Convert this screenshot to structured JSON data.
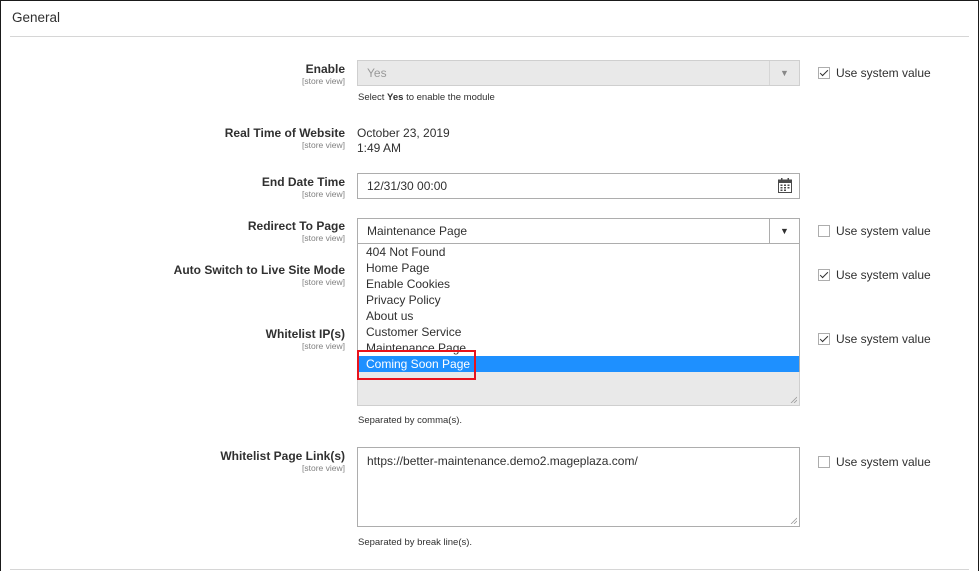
{
  "section": {
    "title": "General"
  },
  "fields": {
    "enable": {
      "label": "Enable",
      "scope": "[store view]",
      "value": "Yes",
      "note_prefix": "Select ",
      "note_bold": "Yes",
      "note_suffix": " to enable the module",
      "use_system_value": "Use system value"
    },
    "real_time": {
      "label": "Real Time of Website",
      "scope": "[store view]",
      "date": "October 23, 2019",
      "time": "1:49 AM"
    },
    "end_date_time": {
      "label": "End Date Time",
      "scope": "[store view]",
      "value": "12/31/30 00:00"
    },
    "redirect_to_page": {
      "label": "Redirect To Page",
      "scope": "[store view]",
      "value": "Maintenance Page",
      "use_system_value": "Use system value",
      "options": [
        "404 Not Found",
        "Home Page",
        "Enable Cookies",
        "Privacy Policy",
        "About us",
        "Customer Service",
        "Maintenance Page",
        "Coming Soon Page"
      ]
    },
    "auto_switch": {
      "label": "Auto Switch to Live Site Mode",
      "scope": "[store view]",
      "use_system_value": "Use system value"
    },
    "whitelist_ips": {
      "label": "Whitelist IP(s)",
      "scope": "[store view]",
      "note": "Separated by comma(s).",
      "use_system_value": "Use system value"
    },
    "whitelist_page_links": {
      "label": "Whitelist Page Link(s)",
      "scope": "[store view]",
      "value": "https://better-maintenance.demo2.mageplaza.com/",
      "note": "Separated by break line(s).",
      "use_system_value": "Use system value"
    }
  },
  "colors": {
    "selected_option": "#1e90ff",
    "highlight_border": "#e8131d"
  },
  "icons": {
    "calendar": "calendar-icon",
    "select_arrow": "chevron-down-icon",
    "checkbox_check": "check-icon"
  }
}
